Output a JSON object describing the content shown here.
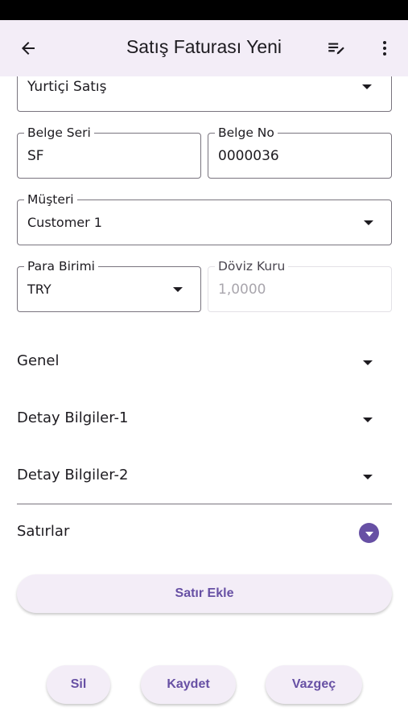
{
  "app_bar": {
    "title": "Satış Faturası Yeni",
    "back_icon": "arrow-back-icon",
    "edit_icon": "playlist-edit-icon",
    "more_icon": "more-vert-icon"
  },
  "form": {
    "top_partial_value": "Yurtiçi Satış",
    "belge_seri": {
      "label": "Belge Seri",
      "value": "SF"
    },
    "belge_no": {
      "label": "Belge No",
      "value": "0000036"
    },
    "musteri": {
      "label": "Müşteri",
      "value": "Customer 1"
    },
    "para_birimi": {
      "label": "Para Birimi",
      "value": "TRY"
    },
    "doviz_kuru": {
      "label": "Döviz Kuru",
      "value": "1,0000"
    }
  },
  "sections": {
    "genel": "Genel",
    "detay1": "Detay Bilgiler-1",
    "detay2": "Detay Bilgiler-2",
    "satirlar": "Satırlar"
  },
  "buttons": {
    "satir_ekle": "Satır Ekle",
    "sil": "Sil",
    "kaydet": "Kaydet",
    "vazgec": "Vazgeç"
  },
  "colors": {
    "primary": "#6750a4",
    "surface_tint": "#f3edf7",
    "outline": "#79747e"
  }
}
